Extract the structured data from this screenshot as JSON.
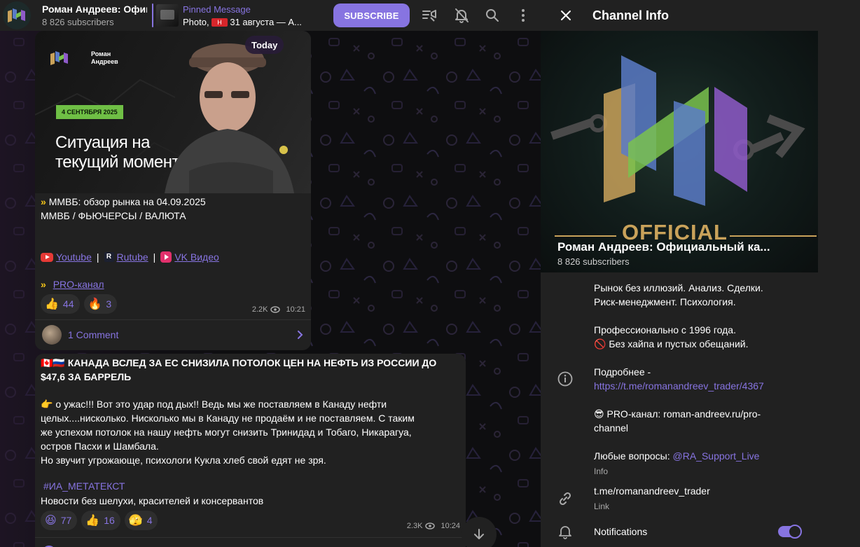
{
  "header": {
    "channel_title": "Роман Андреев: Официальный канал",
    "subscribers": "8 826 subscribers",
    "pinned_label": "Pinned Message",
    "pinned_prefix": "Photo,",
    "pinned_tag": "Н",
    "pinned_rest": "31 августа — А...",
    "subscribe_label": "SUBSCRIBE",
    "icons": [
      "video-chat-icon",
      "mute-icon",
      "search-icon",
      "more-icon"
    ]
  },
  "post1": {
    "date_pill": "Today",
    "image": {
      "brand_line1": "Роман",
      "brand_line2": "Андреев",
      "date_badge": "4 СЕНТЯБРЯ 2025",
      "headline_line1": "Ситуация на",
      "headline_line2": "текущий момент"
    },
    "line1": "ММВБ: обзор рынка на 04.09.2025",
    "line2": "ММВБ / ФЬЮЧЕРСЫ / ВАЛЮТА",
    "links": [
      {
        "label": "Youtube"
      },
      {
        "label": "Rutube"
      },
      {
        "label": "VK Видео"
      }
    ],
    "pro_link": "PRO-канал",
    "reactions": [
      {
        "emoji": "👍",
        "count": "44"
      },
      {
        "emoji": "🔥",
        "count": "3"
      }
    ],
    "views": "2.2K",
    "time": "10:21",
    "comments": "1 Comment"
  },
  "post2": {
    "headline": "🇨🇦🇷🇺 КАНАДА ВСЛЕД ЗА ЕС СНИЗИЛА ПОТОЛОК ЦЕН НА НЕФТЬ ИЗ РОССИИ ДО $47,6 ЗА БАРРЕЛЬ",
    "body_line1": "👉 о ужас!!! Вот это удар под дых!! Ведь мы же поставляем в Канаду нефти",
    "body_line2": "целых....нисколько. Нисколько мы в Канаду не продаём и не поставляем. С таким",
    "body_line3": "же успехом потолок на нашу нефть могут снизить Тринидад и Тобаго, Никарагуа,",
    "body_line4": "остров Пасхи и Шамбала.",
    "body_line5": "Но звучит угрожающе, психологи Кукла хлеб свой едят не зря.",
    "hashtag": "#ИА_МЕТАТЕКСТ",
    "tagline": "Новости без шелухи, красителей и консервантов",
    "reactions": [
      {
        "emoji": "😆",
        "count": "77"
      },
      {
        "emoji": "👍",
        "count": "16"
      },
      {
        "emoji": "🫣",
        "count": "4"
      }
    ],
    "views": "2.3K",
    "time": "10:24"
  },
  "panel": {
    "title": "Channel Info",
    "cover_official": "OFFICIAL",
    "name": "Роман Андреев: Официальный ка...",
    "subscribers": "8 826 subscribers",
    "desc_line1": "Рынок без иллюзий. Анализ. Сделки.",
    "desc_line2": "Риск-менеджмент. Психология.",
    "desc_line3": "Профессионально с 1996 года.",
    "desc_line4": "🚫 Без хайпа и пустых обещаний.",
    "more_label": "Подробнее -",
    "more_link": "https://t.me/romanandreev_trader/4367",
    "pro_line1": "😎 PRO-канал: roman-andreev.ru/pro-",
    "pro_line2": "channel",
    "questions_prefix": "Любые вопросы: ",
    "questions_handle": "@RA_Support_Live",
    "info_caption": "Info",
    "link_value": "t.me/romanandreev_trader",
    "link_caption": "Link",
    "notifications_label": "Notifications",
    "notifications_on": true
  },
  "colors": {
    "accent": "#8774e1",
    "panel_bg": "#212121",
    "chat_bg": "#0e0e10"
  }
}
